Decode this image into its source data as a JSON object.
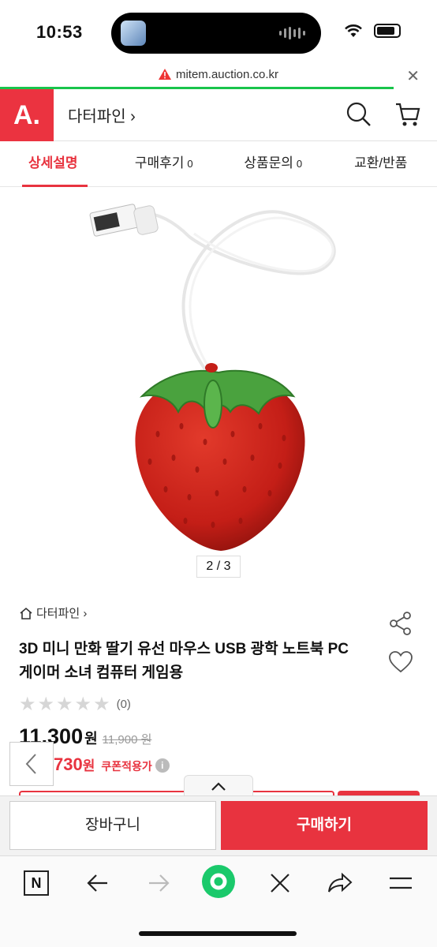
{
  "status_bar": {
    "time": "10:53"
  },
  "browser": {
    "url": "mitem.auction.co.kr",
    "load_progress_percent": 90
  },
  "header": {
    "logo": "A.",
    "store_name": "다터파인 ›"
  },
  "tabs": [
    {
      "label": "상세설명",
      "count": ""
    },
    {
      "label": "구매후기",
      "count": "0"
    },
    {
      "label": "상품문의",
      "count": "0"
    },
    {
      "label": "교환/반품",
      "count": ""
    }
  ],
  "gallery": {
    "pager": "2 / 3"
  },
  "product": {
    "breadcrumb": "다터파인 ›",
    "title": "3D 미니 만화 딸기 유선 마우스 USB 광학 노트북 PC 게이머 소녀 컴퓨터 게임용",
    "rating_count": "(0)",
    "rating_stars": 0,
    "price": "11,300",
    "price_unit": "원",
    "original_price": "11,900 원",
    "coupon_price": "730",
    "coupon_unit": "원",
    "coupon_label": "쿠폰적용가",
    "info_icon": "i"
  },
  "actions": {
    "cart": "장바구니",
    "buy": "구매하기"
  },
  "browser_toolbar": {
    "n_label": "N"
  },
  "colors": {
    "accent": "#e8333f",
    "progress": "#19c44b",
    "browser_green": "#1ac96b"
  }
}
